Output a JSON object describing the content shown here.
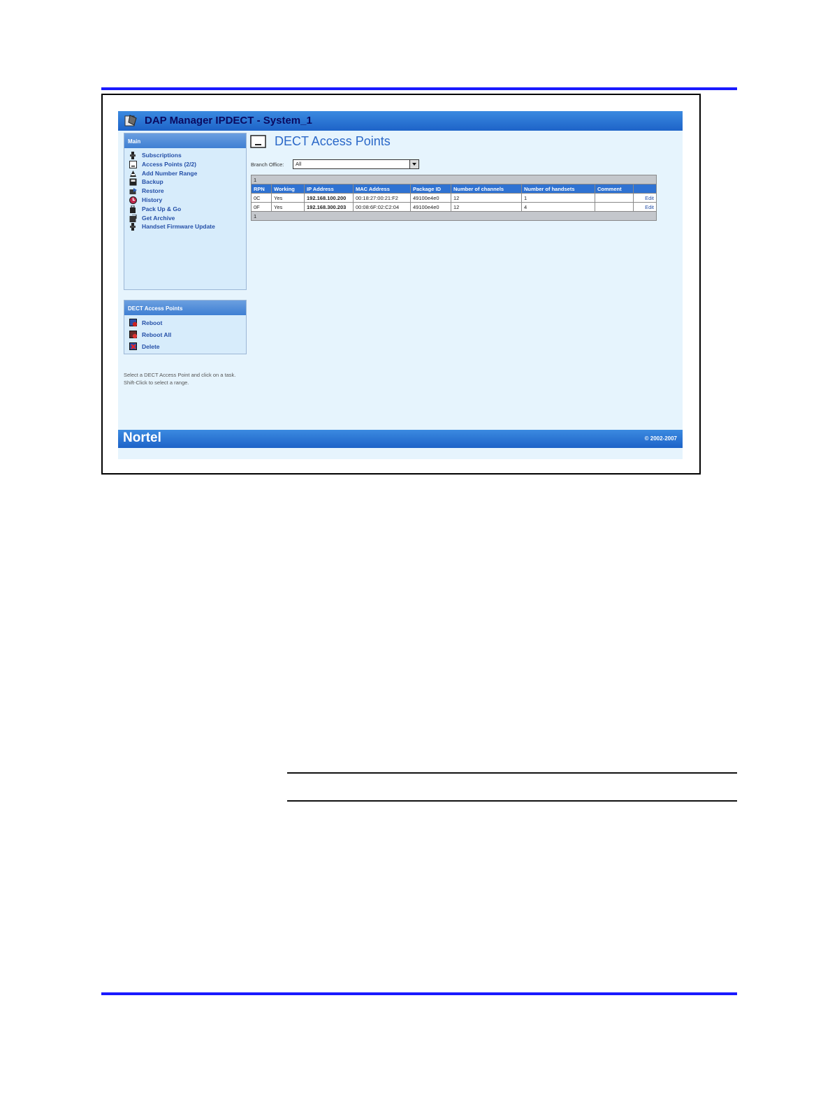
{
  "window": {
    "title": "DAP Manager IPDECT - System_1"
  },
  "main_menu": {
    "header": "Main",
    "items": [
      {
        "label": "Subscriptions",
        "icon": "subscriptions-icon"
      },
      {
        "label": "Access Points (2/2)",
        "icon": "access-point-icon"
      },
      {
        "label": "Add Number Range",
        "icon": "add-number-range-icon"
      },
      {
        "label": "Backup",
        "icon": "backup-icon"
      },
      {
        "label": "Restore",
        "icon": "restore-icon"
      },
      {
        "label": "History",
        "icon": "history-icon"
      },
      {
        "label": "Pack Up & Go",
        "icon": "pack-up-icon"
      },
      {
        "label": "Get Archive",
        "icon": "archive-icon"
      },
      {
        "label": "Handset Firmware Update",
        "icon": "firmware-icon"
      }
    ]
  },
  "tasks": {
    "header": "DECT Access Points",
    "items": [
      {
        "label": "Reboot",
        "icon": "reboot-icon"
      },
      {
        "label": "Reboot All",
        "icon": "reboot-all-icon"
      },
      {
        "label": "Delete",
        "icon": "delete-icon"
      }
    ]
  },
  "hint": "Select a DECT Access Point and click on a task. Shift-Click to select a range.",
  "page": {
    "heading": "DECT Access Points",
    "filter_label": "Branch Office:",
    "filter_value": "All"
  },
  "table": {
    "page_label": "1",
    "columns": [
      "RPN",
      "Working",
      "IP Address",
      "MAC Address",
      "Package ID",
      "Number of channels",
      "Number of handsets",
      "Comment",
      ""
    ],
    "rows": [
      [
        "0C",
        "Yes",
        "192.168.100.200",
        "00:18:27:00:21:F2",
        "49100e4e0",
        "12",
        "1",
        "",
        "Edit"
      ],
      [
        "0F",
        "Yes",
        "192.168.300.203",
        "00:08:6F:02:C2:04",
        "49100e4e0",
        "12",
        "4",
        "",
        "Edit"
      ]
    ]
  },
  "footer": {
    "brand": "Nortel",
    "copyright": "© 2002-2007"
  },
  "colors": {
    "rule": "#1a1aff",
    "titlebar": "#1d63c8",
    "background": "#e6f4fd"
  }
}
